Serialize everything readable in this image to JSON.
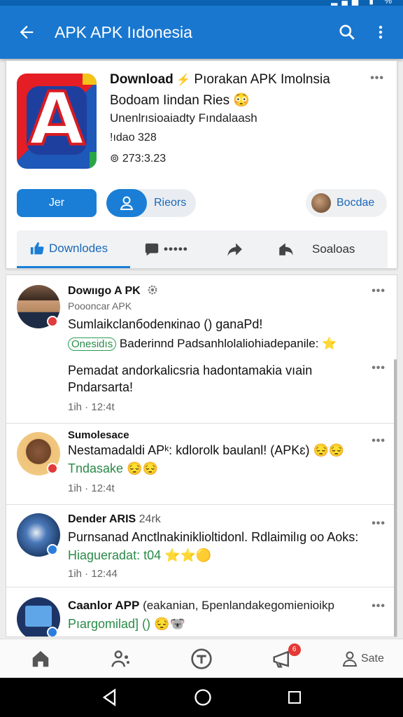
{
  "status_bar": {
    "icons": "▂▄▆ ▮ %"
  },
  "app_bar": {
    "title": "APK APK Iıdonesia"
  },
  "group": {
    "title_bold": "Download",
    "title_rest": " Pıorakan APK Imolnsia",
    "subtitle": "Bodoam Iindan Ries 😳",
    "description": "Unenlrısioaiadty Fındalaash",
    "members": "!ıdao 328",
    "count": "⊚ 273:3.23",
    "join_label": "Jer",
    "invite_label": "Rieors",
    "share_label": "Bocdae",
    "tabs": {
      "downloads": "Downlodes",
      "comments_dots": "•••••",
      "saved": "Soaloas"
    }
  },
  "posts": [
    {
      "name": "Dowııgo A PK",
      "handle": "Poooncar APK",
      "text1": "Sumlaikclanбodenкinao () ganaPd!",
      "chip": "Onesidıs",
      "text2": " Baderinnd Padsanhlolaliohiadepanile: ⭐",
      "text3": "Pemadat andorkalicsria hadontamakia vıain",
      "text4": "Pndarsarta!",
      "time": "1ih · 12:4t"
    },
    {
      "name": "Sumolesace",
      "text1": "Nestamadaldi APᵏ: kdlorolk baulanl! (APKɛ) 😔😔",
      "text2": "Tndasake 😔😔",
      "time": "1ih · 12:4t"
    },
    {
      "name": "Dender ARIS",
      "name_extra": " 24rk",
      "text1": "Purnsanad Anctlnakiniklioltidonl. Rdlaimilıg oo Aoks:",
      "text2": "Hiagueradat: t04 ⭐⭐🟡",
      "time": "1ih · 12:44"
    },
    {
      "name": "Caanlor APP",
      "name_extra": " (eakanian, Бpenlandakegomienioikp",
      "text1": "Pıargomilad] () 😔🐨"
    }
  ],
  "bottom_nav": {
    "badge": "6",
    "profile_label": "Sate"
  },
  "colors": {
    "primary": "#1a77cf",
    "accent": "#1a7ed6",
    "green": "#2a8a48"
  }
}
